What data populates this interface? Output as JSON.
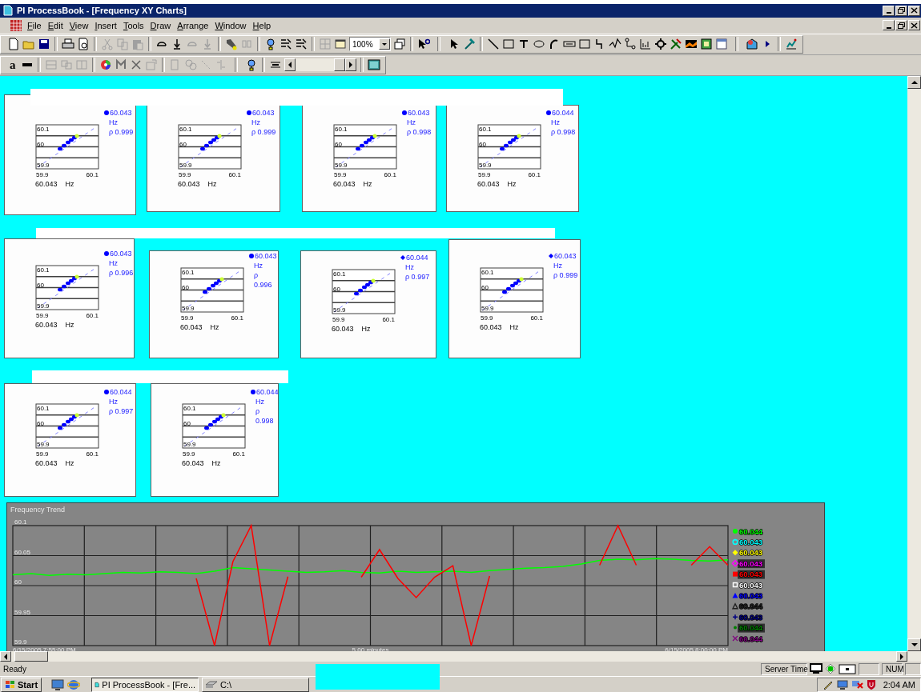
{
  "window": {
    "title": "PI ProcessBook - [Frequency XY Charts]"
  },
  "menu": [
    "File",
    "Edit",
    "View",
    "Insert",
    "Tools",
    "Draw",
    "Arrange",
    "Window",
    "Help"
  ],
  "toolbar": {
    "zoom": "100%",
    "font_button": "a"
  },
  "tiles": [
    {
      "value": "60.043",
      "kind": "circle",
      "unit": "Hz",
      "correlation": "ρ 0.999",
      "y_labels": [
        "60.1",
        "60",
        "59.9"
      ],
      "x_labels": [
        "59.9",
        "60.1"
      ],
      "footer_value": "60.043",
      "footer_unit": "Hz"
    },
    {
      "value": "60.043",
      "kind": "circle",
      "unit": "Hz",
      "correlation": "ρ 0.999",
      "y_labels": [
        "60.1",
        "60",
        "59.9"
      ],
      "x_labels": [
        "59.9",
        "60.1"
      ],
      "footer_value": "60.043",
      "footer_unit": "Hz"
    },
    {
      "value": "60.043",
      "kind": "circle",
      "unit": "Hz",
      "correlation": "ρ 0.998",
      "y_labels": [
        "60.1",
        "60",
        "59.9"
      ],
      "x_labels": [
        "59.9",
        "60.1"
      ],
      "footer_value": "60.043",
      "footer_unit": "Hz"
    },
    {
      "value": "60.044",
      "kind": "circle",
      "unit": "Hz",
      "correlation": "ρ 0.998",
      "y_labels": [
        "60.1",
        "60",
        "59.9"
      ],
      "x_labels": [
        "59.9",
        "60.1"
      ],
      "footer_value": "60.043",
      "footer_unit": "Hz"
    },
    {
      "value": "60.043",
      "kind": "circle",
      "unit": "Hz",
      "correlation": "ρ 0.996",
      "y_labels": [
        "60.1",
        "60",
        "59.9"
      ],
      "x_labels": [
        "59.9",
        "60.1"
      ],
      "footer_value": "60.043",
      "footer_unit": "Hz"
    },
    {
      "value": "60.043",
      "kind": "circle",
      "unit": "Hz",
      "correlation": "ρ 0.996",
      "y_labels": [
        "60.1",
        "60",
        "59.9"
      ],
      "x_labels": [
        "59.9",
        "60.1"
      ],
      "footer_value": "60.043",
      "footer_unit": "Hz"
    },
    {
      "value": "60.044",
      "kind": "diamond",
      "unit": "Hz",
      "correlation": "ρ 0.997",
      "y_labels": [
        "60.1",
        "60",
        "59.9"
      ],
      "x_labels": [
        "59.9",
        "60.1"
      ],
      "footer_value": "60.043",
      "footer_unit": "Hz"
    },
    {
      "value": "60.043",
      "kind": "diamond",
      "unit": "Hz",
      "correlation": "ρ 0.999",
      "y_labels": [
        "60.1",
        "60",
        "59.9"
      ],
      "x_labels": [
        "59.9",
        "60.1"
      ],
      "footer_value": "60.043",
      "footer_unit": "Hz"
    },
    {
      "value": "60.044",
      "kind": "circle",
      "unit": "Hz",
      "correlation": "ρ 0.997",
      "y_labels": [
        "60.1",
        "60",
        "59.9"
      ],
      "x_labels": [
        "59.9",
        "60.1"
      ],
      "footer_value": "60.043",
      "footer_unit": "Hz"
    },
    {
      "value": "60.044",
      "kind": "circle",
      "unit": "Hz",
      "correlation": "ρ 0.998",
      "y_labels": [
        "60.1",
        "60",
        "59.9"
      ],
      "x_labels": [
        "59.9",
        "60.1"
      ],
      "footer_value": "60.043",
      "footer_unit": "Hz"
    }
  ],
  "trend": {
    "chart_data": {
      "type": "line",
      "title": "Frequency Trend",
      "xlabel": "5.00 minutes",
      "ylim": [
        59.9,
        60.1
      ],
      "yticks": [
        59.9,
        59.95,
        60,
        60.05,
        60.1
      ],
      "grid": true,
      "series": [
        {
          "color": "#00ff00",
          "values": [
            60.018,
            60.02,
            60.017,
            60.019,
            60.018,
            60.02,
            60.022,
            60.021,
            60.023,
            60.022,
            60.02,
            60.024,
            60.03,
            60.028,
            60.026,
            60.024,
            60.022,
            60.023,
            60.025,
            60.022,
            60.021,
            60.024,
            60.022,
            60.023,
            60.024,
            60.022,
            60.025,
            60.027,
            60.029,
            60.03,
            60.032,
            60.036,
            60.042,
            60.044,
            60.043,
            60.045,
            60.044,
            60.042,
            60.041,
            60.043
          ]
        },
        {
          "color": "#ff0000",
          "values": [
            null,
            null,
            null,
            null,
            null,
            null,
            null,
            null,
            null,
            null,
            60.012,
            59.9,
            60.04,
            60.1,
            59.9,
            60.015,
            null,
            null,
            null,
            60.014,
            60.06,
            60.012,
            59.98,
            60.014,
            60.033,
            59.9,
            60.016,
            null,
            null,
            null,
            null,
            null,
            60.034,
            60.1,
            60.034,
            null,
            null,
            60.034,
            60.065,
            60.034
          ]
        }
      ]
    },
    "time_start": "6/15/2005 7:55:00 PM",
    "time_end": "6/15/2005 8:00:00 PM",
    "legend": [
      {
        "value": "60.044",
        "color": "#00ff00",
        "kind": "filled-circle"
      },
      {
        "value": "60.043",
        "color": "#00ffff",
        "kind": "open-circle"
      },
      {
        "value": "60.043",
        "color": "#ffff00",
        "kind": "filled-diamond"
      },
      {
        "value": "60.043",
        "color": "#ff00ff",
        "kind": "open-diamond"
      },
      {
        "value": "60.043",
        "color": "#ff0000",
        "kind": "filled-square"
      },
      {
        "value": "60.043",
        "color": "#ffffff",
        "kind": "open-square"
      },
      {
        "value": "60.043",
        "color": "#0000ff",
        "kind": "filled-triangle"
      },
      {
        "value": "60.044",
        "color": "#202020",
        "kind": "open-triangle"
      },
      {
        "value": "60.043",
        "color": "#000080",
        "kind": "plus"
      },
      {
        "value": "60.044",
        "color": "#008000",
        "kind": "dot"
      },
      {
        "value": "60.044",
        "color": "#800080",
        "kind": "cross"
      }
    ]
  },
  "status_bar": {
    "text": "Ready",
    "server_time": "Server Time",
    "num": "NUM"
  },
  "taskbar": {
    "start": "Start",
    "tasks": [
      {
        "label": "PI ProcessBook - [Fre...",
        "selected": true
      },
      {
        "label": "C:\\",
        "selected": false
      }
    ],
    "clock": "2:04 AM"
  }
}
